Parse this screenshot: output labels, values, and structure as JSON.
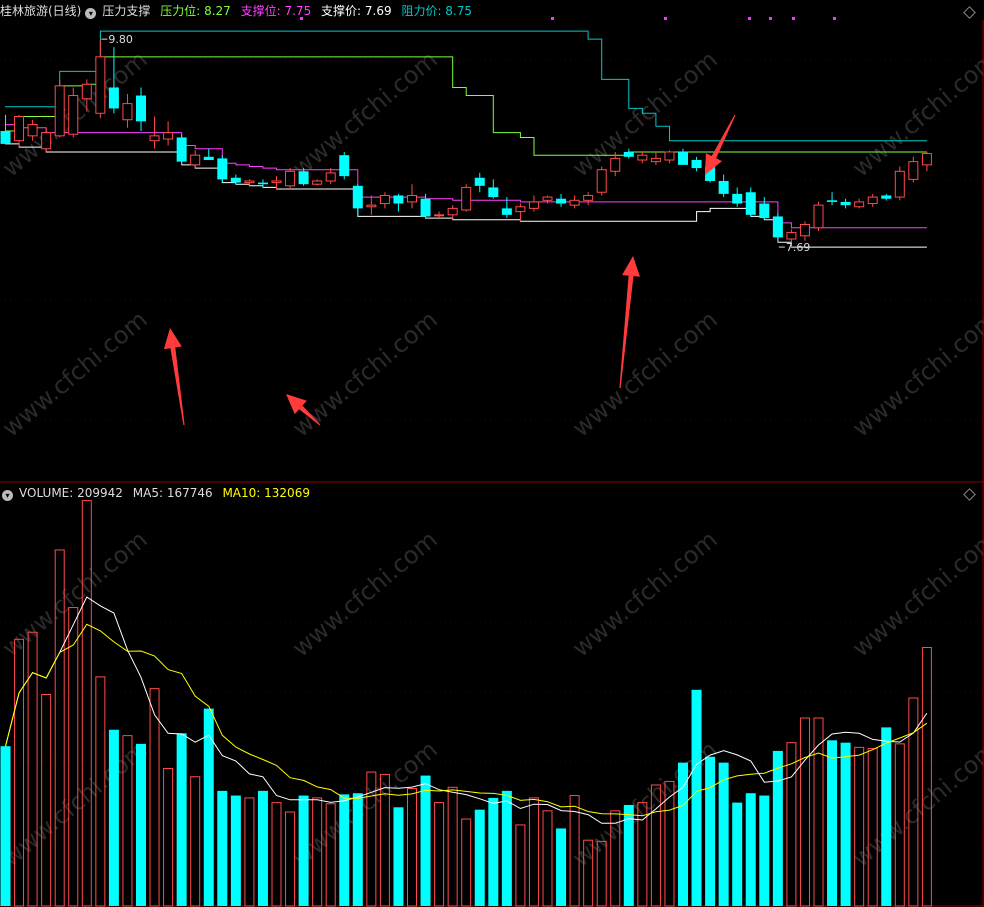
{
  "header": {
    "stock_title": "桂林旅游(日线)",
    "indicator_name": "压力支撑",
    "pressure_label": "压力位: ",
    "pressure_value": "8.27",
    "support_label": "支撑位: ",
    "support_value": "7.75",
    "support_price_label": "支撑价: ",
    "support_price_value": "7.69",
    "resist_price_label": "阻力价: ",
    "resist_price_value": "8.75"
  },
  "volume_header": {
    "volume_label": "VOLUME: ",
    "volume_value": "209942",
    "ma5_label": "MA5: ",
    "ma5_value": "167746",
    "ma10_label": "MA10: ",
    "ma10_value": "132069"
  },
  "watermark": "www.cfchi.com",
  "colors": {
    "up": "#ff4a4a",
    "down": "#00ffff",
    "pressure": "#7fff3f",
    "support": "#ff3fff",
    "support_price": "#ffffff",
    "resist_price": "#00c8c8",
    "ma5": "#ffffff",
    "ma10": "#ffff00",
    "divider": "#8b0000",
    "arrow": "#ff3b3b",
    "marker": "#ff33ff"
  },
  "chart_data": [
    {
      "type": "candlestick",
      "title": "桂林旅游(日线) 压力支撑",
      "candles": [
        {
          "o": 8.18,
          "h": 8.28,
          "l": 8.1,
          "c": 8.1
        },
        {
          "o": 8.12,
          "h": 8.28,
          "l": 8.08,
          "c": 8.27
        },
        {
          "o": 8.15,
          "h": 8.25,
          "l": 8.12,
          "c": 8.22
        },
        {
          "o": 8.07,
          "h": 8.2,
          "l": 8.05,
          "c": 8.17
        },
        {
          "o": 8.15,
          "h": 8.5,
          "l": 8.14,
          "c": 8.46
        },
        {
          "o": 8.16,
          "h": 8.45,
          "l": 8.14,
          "c": 8.4
        },
        {
          "o": 8.38,
          "h": 8.5,
          "l": 8.3,
          "c": 8.47
        },
        {
          "o": 8.29,
          "h": 8.75,
          "l": 8.26,
          "c": 8.64
        },
        {
          "o": 8.45,
          "h": 8.7,
          "l": 8.29,
          "c": 8.32
        },
        {
          "o": 8.25,
          "h": 8.41,
          "l": 8.2,
          "c": 8.35
        },
        {
          "o": 8.4,
          "h": 8.45,
          "l": 8.18,
          "c": 8.24
        },
        {
          "o": 8.12,
          "h": 8.27,
          "l": 8.07,
          "c": 8.15
        },
        {
          "o": 8.13,
          "h": 8.24,
          "l": 8.09,
          "c": 8.17
        },
        {
          "o": 8.14,
          "h": 8.16,
          "l": 7.97,
          "c": 7.99
        },
        {
          "o": 7.97,
          "h": 8.06,
          "l": 7.95,
          "c": 8.03
        },
        {
          "o": 8.02,
          "h": 8.07,
          "l": 8.01,
          "c": 8.0
        },
        {
          "o": 8.01,
          "h": 8.03,
          "l": 7.86,
          "c": 7.88
        },
        {
          "o": 7.89,
          "h": 7.91,
          "l": 7.85,
          "c": 7.86
        },
        {
          "o": 7.86,
          "h": 7.88,
          "l": 7.84,
          "c": 7.87
        },
        {
          "o": 7.86,
          "h": 7.88,
          "l": 7.83,
          "c": 7.85
        },
        {
          "o": 7.86,
          "h": 7.9,
          "l": 7.82,
          "c": 7.87
        },
        {
          "o": 7.84,
          "h": 7.95,
          "l": 7.82,
          "c": 7.93
        },
        {
          "o": 7.93,
          "h": 7.95,
          "l": 7.84,
          "c": 7.85
        },
        {
          "o": 7.85,
          "h": 7.88,
          "l": 7.84,
          "c": 7.87
        },
        {
          "o": 7.87,
          "h": 7.95,
          "l": 7.85,
          "c": 7.92
        },
        {
          "o": 8.03,
          "h": 8.05,
          "l": 7.88,
          "c": 7.9
        },
        {
          "o": 7.84,
          "h": 7.85,
          "l": 7.65,
          "c": 7.7
        },
        {
          "o": 7.71,
          "h": 7.78,
          "l": 7.66,
          "c": 7.72
        },
        {
          "o": 7.73,
          "h": 7.8,
          "l": 7.7,
          "c": 7.78
        },
        {
          "o": 7.78,
          "h": 7.79,
          "l": 7.68,
          "c": 7.73
        },
        {
          "o": 7.74,
          "h": 7.85,
          "l": 7.7,
          "c": 7.78
        },
        {
          "o": 7.76,
          "h": 7.79,
          "l": 7.64,
          "c": 7.65
        },
        {
          "o": 7.66,
          "h": 7.68,
          "l": 7.64,
          "c": 7.66
        },
        {
          "o": 7.66,
          "h": 7.72,
          "l": 7.63,
          "c": 7.7
        },
        {
          "o": 7.69,
          "h": 7.85,
          "l": 7.68,
          "c": 7.83
        },
        {
          "o": 7.89,
          "h": 7.92,
          "l": 7.8,
          "c": 7.84
        },
        {
          "o": 7.83,
          "h": 7.88,
          "l": 7.76,
          "c": 7.77
        },
        {
          "o": 7.7,
          "h": 7.77,
          "l": 7.64,
          "c": 7.66
        },
        {
          "o": 7.68,
          "h": 7.73,
          "l": 7.62,
          "c": 7.71
        },
        {
          "o": 7.7,
          "h": 7.78,
          "l": 7.68,
          "c": 7.74
        },
        {
          "o": 7.75,
          "h": 7.78,
          "l": 7.73,
          "c": 7.77
        },
        {
          "o": 7.76,
          "h": 7.79,
          "l": 7.71,
          "c": 7.73
        },
        {
          "o": 7.72,
          "h": 7.78,
          "l": 7.7,
          "c": 7.75
        },
        {
          "o": 7.75,
          "h": 7.8,
          "l": 7.72,
          "c": 7.78
        },
        {
          "o": 7.8,
          "h": 7.96,
          "l": 7.78,
          "c": 7.94
        },
        {
          "o": 7.93,
          "h": 8.05,
          "l": 7.9,
          "c": 8.01
        },
        {
          "o": 8.05,
          "h": 8.07,
          "l": 8.01,
          "c": 8.02
        },
        {
          "o": 8.0,
          "h": 8.05,
          "l": 7.98,
          "c": 8.03
        },
        {
          "o": 7.99,
          "h": 8.05,
          "l": 7.97,
          "c": 8.01
        },
        {
          "o": 8.0,
          "h": 8.06,
          "l": 7.98,
          "c": 8.05
        },
        {
          "o": 8.05,
          "h": 8.07,
          "l": 7.97,
          "c": 7.97
        },
        {
          "o": 8.0,
          "h": 8.02,
          "l": 7.93,
          "c": 7.95
        },
        {
          "o": 7.96,
          "h": 7.99,
          "l": 7.86,
          "c": 7.87
        },
        {
          "o": 7.87,
          "h": 7.91,
          "l": 7.77,
          "c": 7.79
        },
        {
          "o": 7.79,
          "h": 7.83,
          "l": 7.71,
          "c": 7.73
        },
        {
          "o": 7.8,
          "h": 7.83,
          "l": 7.65,
          "c": 7.66
        },
        {
          "o": 7.73,
          "h": 7.77,
          "l": 7.63,
          "c": 7.64
        },
        {
          "o": 7.65,
          "h": 7.67,
          "l": 7.49,
          "c": 7.52
        },
        {
          "o": 7.51,
          "h": 7.57,
          "l": 7.46,
          "c": 7.55
        },
        {
          "o": 7.53,
          "h": 7.62,
          "l": 7.5,
          "c": 7.6
        },
        {
          "o": 7.58,
          "h": 7.74,
          "l": 7.56,
          "c": 7.72
        },
        {
          "o": 7.75,
          "h": 7.8,
          "l": 7.72,
          "c": 7.74
        },
        {
          "o": 7.74,
          "h": 7.76,
          "l": 7.7,
          "c": 7.72
        },
        {
          "o": 7.71,
          "h": 7.76,
          "l": 7.7,
          "c": 7.74
        },
        {
          "o": 7.73,
          "h": 7.79,
          "l": 7.71,
          "c": 7.77
        },
        {
          "o": 7.78,
          "h": 7.79,
          "l": 7.75,
          "c": 7.76
        },
        {
          "o": 7.77,
          "h": 7.96,
          "l": 7.75,
          "c": 7.93
        },
        {
          "o": 7.88,
          "h": 8.02,
          "l": 7.86,
          "c": 7.99
        },
        {
          "o": 7.97,
          "h": 8.05,
          "l": 7.93,
          "c": 8.04
        }
      ],
      "annotations": [
        {
          "text": "9.80",
          "candle": 7,
          "price": 8.75
        },
        {
          "text": "7.69",
          "candle": 57,
          "price": 7.46
        }
      ]
    },
    {
      "type": "bar",
      "title": "VOLUME",
      "values": [
        136000,
        227000,
        233000,
        180000,
        303000,
        254000,
        345000,
        195000,
        150000,
        145000,
        138000,
        185000,
        117000,
        147000,
        110000,
        168000,
        98000,
        94000,
        92000,
        98000,
        88000,
        80000,
        94000,
        92000,
        87000,
        95000,
        96000,
        114000,
        112000,
        84000,
        100000,
        111000,
        88000,
        101000,
        74000,
        82000,
        92000,
        98000,
        69000,
        92000,
        81000,
        66000,
        94000,
        56000,
        55000,
        81000,
        86000,
        88000,
        103000,
        106000,
        122000,
        184000,
        127000,
        122000,
        88000,
        96000,
        94000,
        132000,
        139000,
        160000,
        160000,
        141000,
        139000,
        135000,
        134000,
        152000,
        138000,
        177000,
        220000
      ]
    }
  ]
}
